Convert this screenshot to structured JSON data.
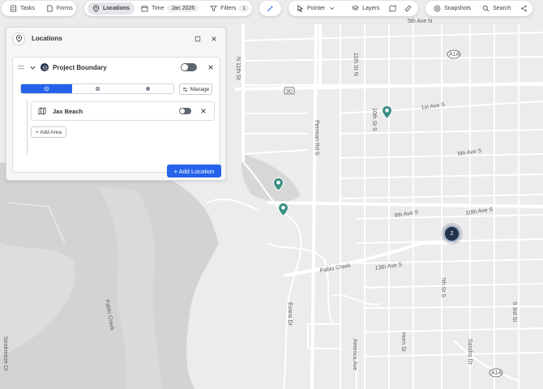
{
  "toolbar": {
    "tasks": "Tasks",
    "forms": "Forms",
    "locations": "Locations",
    "time": "Time",
    "time_value": "Jan 2026",
    "filters": "Filters",
    "filters_count": "1",
    "pointer": "Pointer",
    "layers": "Layers",
    "snapshots": "Snapshots",
    "search": "Search"
  },
  "panel": {
    "title": "Locations",
    "boundary": {
      "title": "Project Boundary",
      "enabled": false,
      "manage_label": "Manage",
      "areas": [
        {
          "title": "Jax Beach",
          "enabled": false
        }
      ],
      "add_area_label": "+ Add Area"
    },
    "add_location_label": "+ Add Location"
  },
  "map": {
    "streets": [
      "5th Ave N",
      "N 11th St",
      "11th St N",
      "10th St S",
      "1st Ave S",
      "Penman Rd S",
      "5th Ave S",
      "9th Ave S",
      "10th Ave S",
      "13th Ave S",
      "7th St S",
      "S 3rd St",
      "Evans Dr",
      "America Ave",
      "Horn St",
      "Sandra Dr",
      "Seabreeze Dr",
      "Pablo Creek",
      "Pablo Creek"
    ],
    "shields": [
      "A1A",
      "90",
      "A1A"
    ],
    "cluster_count": "2",
    "marker_color": "#3a8f86",
    "cluster_color": "#23324a"
  },
  "colors": {
    "accent": "#2563eb",
    "water": "#d1d1d1",
    "land": "#eeeeee",
    "road": "#ffffff"
  }
}
